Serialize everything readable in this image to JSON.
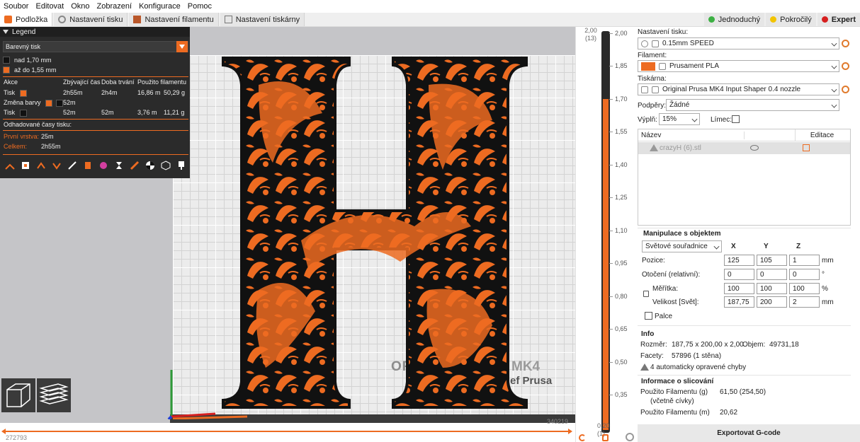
{
  "menu": [
    "Soubor",
    "Editovat",
    "Okno",
    "Zobrazení",
    "Konfigurace",
    "Pomoc"
  ],
  "tabs": [
    {
      "label": "Podložka",
      "active": true
    },
    {
      "label": "Nastavení tisku",
      "active": false
    },
    {
      "label": "Nastavení filamentu",
      "active": false
    },
    {
      "label": "Nastavení tiskárny",
      "active": false
    }
  ],
  "modes": [
    {
      "label": "Jednoduchý",
      "color": "#3cb043"
    },
    {
      "label": "Pokročilý",
      "color": "#f2c400"
    },
    {
      "label": "Expert",
      "color": "#d61f1f"
    }
  ],
  "legend": {
    "title": "Legend",
    "view_type": "Barevný tisk",
    "color_rows": [
      {
        "color": "#111111",
        "label": "nad 1,70 mm"
      },
      {
        "color": "#ed6b21",
        "label": "až do 1,55 mm"
      }
    ],
    "table_headers": [
      "Akce",
      "Zbývající čas",
      "Doba trvání",
      "Použito filamentu"
    ],
    "table_rows": [
      {
        "action": "Tisk",
        "color": "#ed6b21",
        "color2": "",
        "remaining": "2h55m",
        "duration": "2h4m",
        "length": "16,86 m",
        "weight": "50,29 g"
      },
      {
        "action": "Změna barvy",
        "color": "#ed6b21",
        "color2": "#111111",
        "remaining": "52m",
        "duration": "",
        "length": "",
        "weight": ""
      },
      {
        "action": "Tisk",
        "color": "#111111",
        "color2": "",
        "remaining": "52m",
        "duration": "52m",
        "length": "3,76 m",
        "weight": "11,21 g"
      }
    ],
    "estimates_title": "Odhadované časy tisku:",
    "first_layer_label": "První vrstva:",
    "first_layer_value": "25m",
    "total_label": "Celkem:",
    "total_value": "2h55m"
  },
  "bed": {
    "brand": "ORI",
    "model": "MK4",
    "sub": "ef Prusa"
  },
  "hslider": {
    "left_value": "272793",
    "right_value": "340219"
  },
  "vslider": {
    "top_value": "2,00",
    "top_layer": "(13)",
    "bottom_value": "0,20",
    "bottom_layer": "(1)",
    "ticks": [
      "2,00",
      "1,85",
      "1,70",
      "1,55",
      "1,40",
      "1,25",
      "1,10",
      "0,95",
      "0,80",
      "0,65",
      "0,50",
      "0,35",
      "0,20"
    ]
  },
  "sidebar": {
    "print_settings_label": "Nastavení tisku:",
    "print_profile": "0.15mm SPEED",
    "filament_label": "Filament:",
    "filament_profile": "Prusament PLA",
    "filament_color": "#ed6b21",
    "printer_label": "Tiskárna:",
    "printer_profile": "Original Prusa MK4 Input Shaper 0.4 nozzle",
    "supports_label": "Podpěry:",
    "supports_value": "Žádné",
    "infill_label": "Výplň:",
    "infill_value": "15%",
    "brim_label": "Límec:",
    "list_col_name": "Název",
    "list_col_edit": "Editace",
    "object_name": "crazyH (6).stl",
    "manip_title": "Manipulace s objektem",
    "coord_system": "Světové souřadnice",
    "axis_x": "X",
    "axis_y": "Y",
    "axis_z": "Z",
    "position_label": "Pozice:",
    "position": [
      "125",
      "105",
      "1"
    ],
    "position_unit": "mm",
    "rotation_label": "Otočení (relativní):",
    "rotation": [
      "0",
      "0",
      "0"
    ],
    "rotation_unit": "°",
    "scale_label": "Měřítka:",
    "scale": [
      "100",
      "100",
      "100"
    ],
    "scale_unit": "%",
    "size_label": "Velikost [Svět]:",
    "size": [
      "187,75",
      "200",
      "2"
    ],
    "size_unit": "mm",
    "inches_label": "Palce",
    "info_title": "Info",
    "dims_label": "Rozměr:",
    "dims_value": "187,75 x 200,00 x 2,00",
    "volume_label": "Objem:",
    "volume_value": "49731,18",
    "facets_label": "Facety:",
    "facets_value": "57896 (1 stěna)",
    "errors_text": "4 automaticky opravené chyby",
    "slice_title": "Informace o slicování",
    "used_g_label": "Použito Filamentu (g)",
    "used_g_sub": "(včetně cívky)",
    "used_g_value": "61,50 (254,50)",
    "used_m_label": "Použito Filamentu (m)",
    "used_m_value": "20,62",
    "export_label": "Exportovat G-code"
  },
  "colors": {
    "accent": "#ed6b21",
    "dark": "#2b2b2b"
  }
}
